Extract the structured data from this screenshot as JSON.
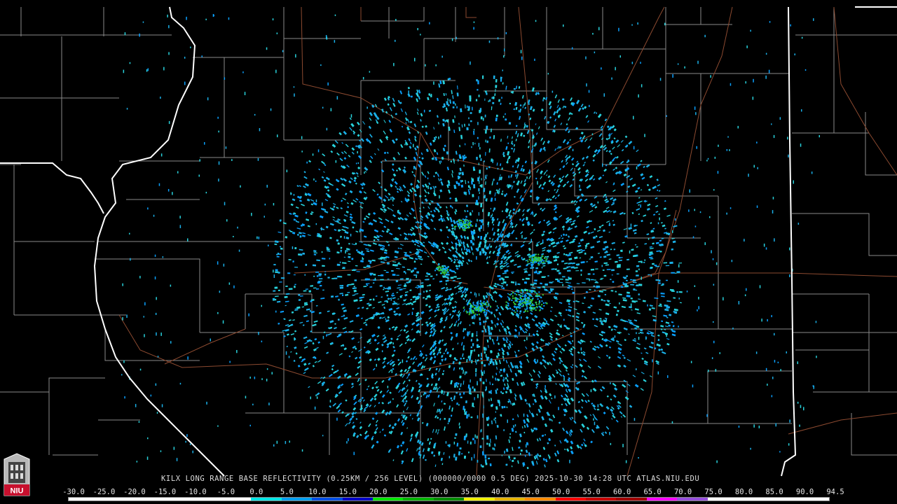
{
  "title": "KILX LONG RANGE BASE REFLECTIVITY (0.25KM / 256 LEVEL) (000000/0000 0.5 DEG) 2025-10-30 14:28 UTC  ATLAS.NIU.EDU",
  "logo_text": "NIU",
  "scale": {
    "ticks": [
      "-30.0",
      "-25.0",
      "-20.0",
      "-15.0",
      "-10.0",
      "-5.0",
      "0.0",
      "5.0",
      "10.0",
      "15.0",
      "20.0",
      "25.0",
      "30.0",
      "35.0",
      "40.0",
      "45.0",
      "50.0",
      "55.0",
      "60.0",
      "65.0",
      "70.0",
      "75.0",
      "80.0",
      "85.0",
      "90.0",
      "94.5"
    ],
    "colors": [
      "#ffffff",
      "#ffffff",
      "#ffffff",
      "#ffffff",
      "#ffffff",
      "#ffffff",
      "#00e6e6",
      "#00a0f0",
      "#0050e6",
      "#0000c8",
      "#00e600",
      "#00b400",
      "#008c00",
      "#f0f000",
      "#e6b400",
      "#ff8c00",
      "#ff0000",
      "#c80000",
      "#a00000",
      "#ff00ff",
      "#9650dc",
      "#ffffff",
      "#ffffff",
      "#ffffff",
      "#ffffff"
    ]
  },
  "map_colors": {
    "county_lines": "#8a8a8a",
    "state_lines": "#ffffff",
    "highways": "#8c4a30",
    "echo_primary": "#1ab0e8",
    "echo_secondary": "#0aa0ff",
    "echo_light": "#28d2dc",
    "echo_green": "#32c832"
  }
}
